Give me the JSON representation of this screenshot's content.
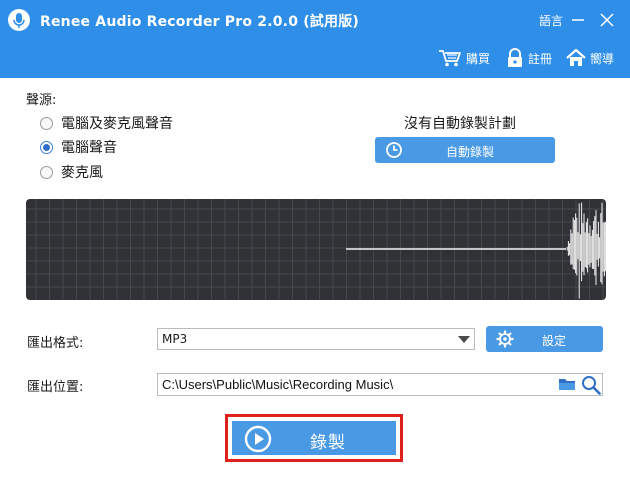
{
  "window": {
    "title": "Renee Audio Recorder Pro 2.0.0 (試用版)",
    "language_label": "語言"
  },
  "header": {
    "buy_label": "購買",
    "register_label": "註冊",
    "guide_label": "嚮導"
  },
  "source": {
    "label": "聲源:",
    "options": [
      {
        "label": "電腦及麥克風聲音",
        "selected": false
      },
      {
        "label": "電腦聲音",
        "selected": true
      },
      {
        "label": "麥克風",
        "selected": false
      }
    ]
  },
  "schedule": {
    "status_text": "沒有自動錄製計劃",
    "auto_record_label": "自動錄製"
  },
  "output": {
    "format_label": "匯出格式:",
    "format_value": "MP3",
    "settings_label": "設定",
    "path_label": "匯出位置:",
    "path_value": "C:\\Users\\Public\\Music\\Recording Music\\"
  },
  "record": {
    "label": "錄製"
  },
  "colors": {
    "accent": "#2f8fe8",
    "button": "#4a99e5",
    "highlight_border": "#e0201c",
    "wave_bg": "#303236"
  }
}
